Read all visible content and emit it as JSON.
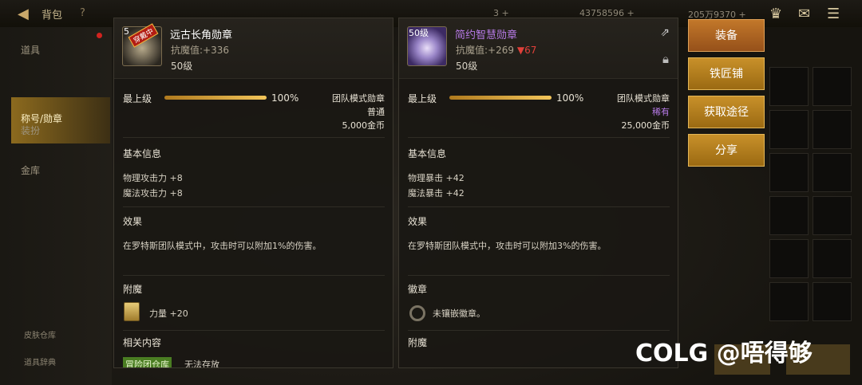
{
  "topbar": {
    "back_icon": "◀",
    "title": "背包",
    "help_icon": "?",
    "res1": "3 +",
    "res2": "43758596 +",
    "res3": "205万9370 +"
  },
  "sidebar": {
    "items": [
      "道具",
      "称号/勋章",
      "装扮",
      "金库"
    ],
    "active_index": 1,
    "bottom": [
      "皮肤仓库",
      "道具辞典"
    ]
  },
  "panels": [
    {
      "level_tag": "5",
      "badge": "穿戴中",
      "name": "远古长角勋章",
      "name_color": "#ffffff",
      "value_label": "抗魔值:",
      "value": "+336",
      "value_down": "",
      "level": "50级",
      "max_label": "最上级",
      "progress": 1.0,
      "progress_text": "100%",
      "type": "团队模式勋章",
      "rarity": "普通",
      "rarity_color": "#e8e2d4",
      "price": "5,000金币",
      "basic_title": "基本信息",
      "stats": [
        "物理攻击力 +8",
        "魔法攻击力 +8"
      ],
      "effect_title": "效果",
      "effect": "在罗特斯团队模式中，攻击时可以附加1%的伤害。",
      "section3_title": "附魔",
      "section3_line": "力量 +20",
      "section4_title": "相关内容",
      "tag": "冒险团仓库",
      "tag_text": "无法存放"
    },
    {
      "level_tag": "50级",
      "name": "简约智慧勋章",
      "name_color": "#b67ae6",
      "value_label": "抗魔值:",
      "value": "+269",
      "value_down": "▼67",
      "level": "50级",
      "max_label": "最上级",
      "progress": 1.0,
      "progress_text": "100%",
      "type": "团队模式勋章",
      "rarity": "稀有",
      "rarity_color": "#b67ae6",
      "price": "25,000金币",
      "basic_title": "基本信息",
      "stats": [
        "物理暴击 +42",
        "魔法暴击 +42"
      ],
      "effect_title": "效果",
      "effect": "在罗特斯团队模式中，攻击时可以附加3%的伤害。",
      "section3_title": "徽章",
      "section3_line": "未镶嵌徽章。",
      "section4_title": "附魔"
    }
  ],
  "buttons": [
    "装备",
    "铁匠铺",
    "获取途径",
    "分享"
  ],
  "watermark": "COLG @唔得够"
}
